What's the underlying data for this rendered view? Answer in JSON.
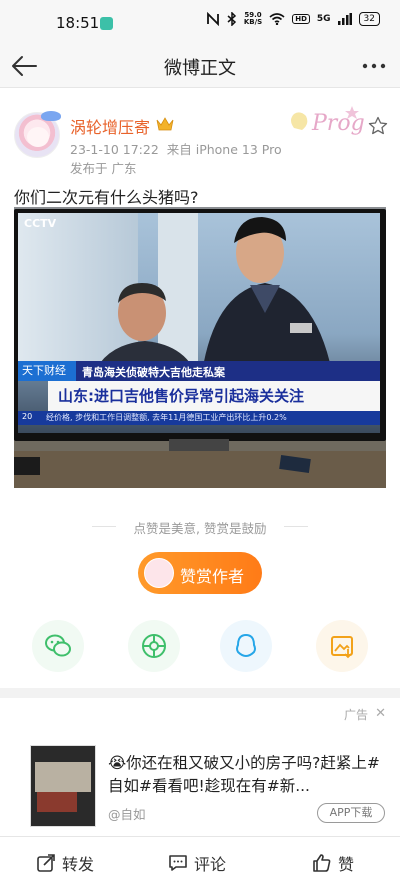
{
  "status_bar": {
    "time": "18:51",
    "speed_value": "59.0",
    "speed_unit": "KB/S",
    "hd": "HD",
    "signal": "5G",
    "battery": "32"
  },
  "titlebar": {
    "title": "微博正文"
  },
  "post": {
    "username": "涡轮增压寄",
    "meta_time": "23-1-10 17:22",
    "meta_source": "来自 iPhone 13 Pro",
    "meta_location": "发布于 广东",
    "text": "你们二次元有什么头猪吗?",
    "image": {
      "channel_logo": "CCTV",
      "tag": "天下财经",
      "headline_small": "青岛海关侦破特大吉他走私案",
      "headline_main": "山东:进口吉他售价异常引起海关关注",
      "ticker_num": "20",
      "ticker": "经价格, 步伐和工作日调整额, 去年11月德国工业产出环比上升0.2%"
    }
  },
  "reward": {
    "hint": "点赞是美意, 赞赏是鼓励",
    "button_label": "赞赏作者"
  },
  "share": [
    {
      "name": "wechat-share",
      "color": "#3fbf6b"
    },
    {
      "name": "moments-share",
      "color": "#3fbf6b"
    },
    {
      "name": "qq-share",
      "color": "#26a6e8"
    },
    {
      "name": "save-image-share",
      "color": "#f2a21a"
    }
  ],
  "ad": {
    "label": "广告",
    "close": "✕",
    "text": "😭你还在租又破又小的房子吗?赶紧上#自如#看看吧!趁现在有#新...",
    "source": "@自如",
    "button": "APP下载"
  },
  "bottom_bar": {
    "repost": "转发",
    "comment": "评论",
    "like": "赞"
  }
}
